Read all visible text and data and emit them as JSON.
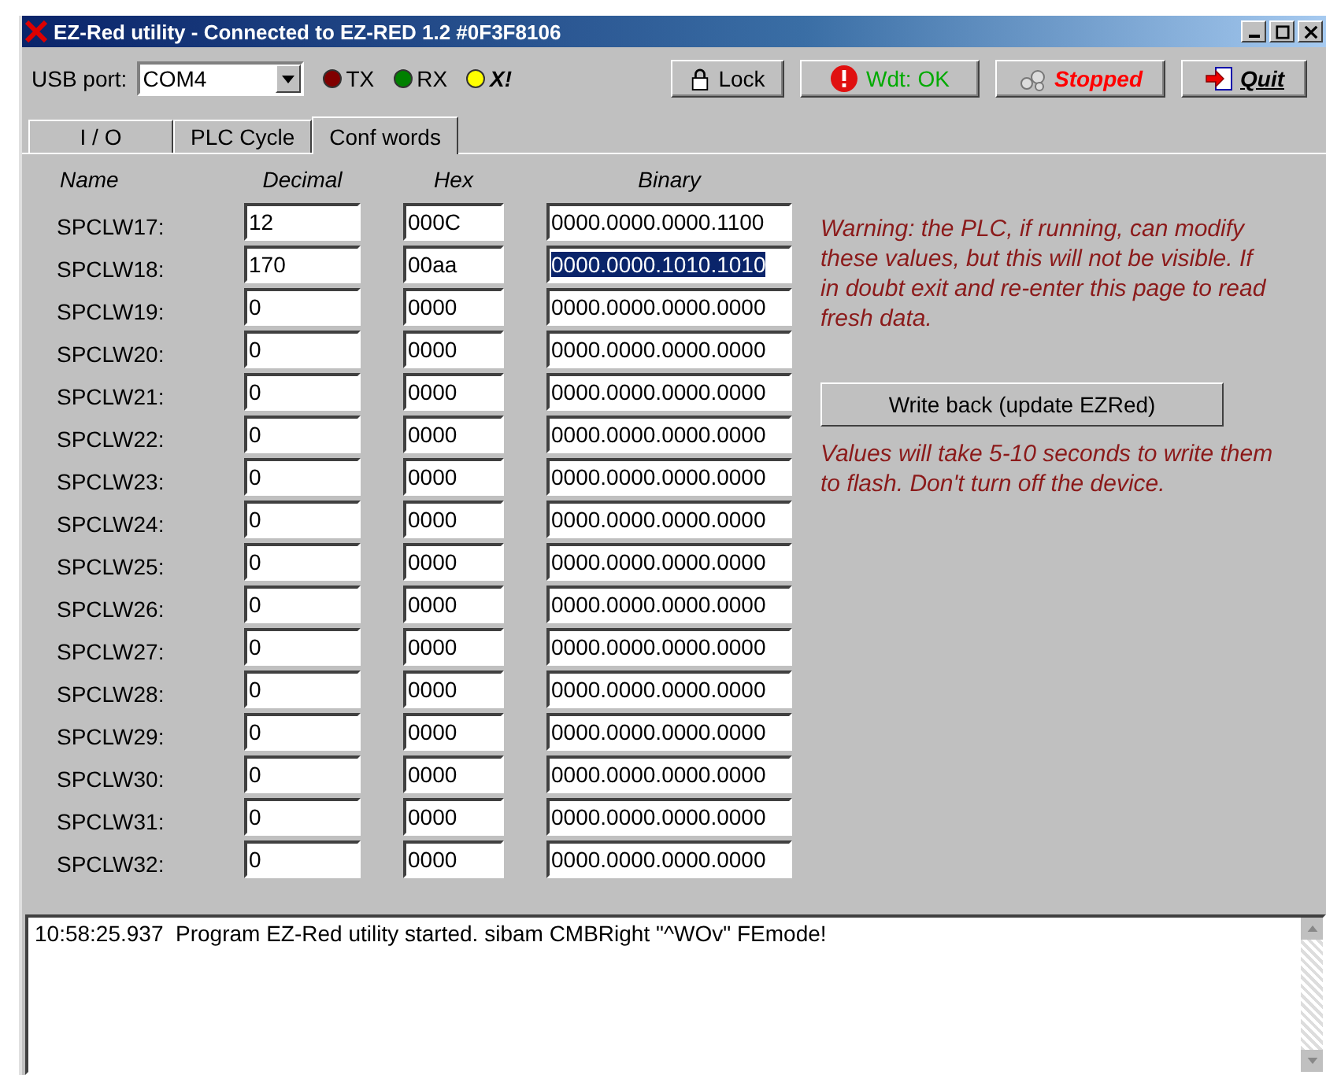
{
  "window": {
    "title": "EZ-Red utility - Connected to EZ-RED 1.2  #0F3F8106"
  },
  "toolbar": {
    "port_label": "USB port:",
    "port_value": "COM4",
    "indicators": [
      {
        "label": "TX",
        "color": "#800000"
      },
      {
        "label": "RX",
        "color": "#008000"
      },
      {
        "label": "X!",
        "color": "#ffff00"
      }
    ],
    "buttons": [
      {
        "kind": "lock",
        "label": "Lock"
      },
      {
        "kind": "wdt",
        "label": "Wdt: OK"
      },
      {
        "kind": "stopped",
        "label": "Stopped"
      },
      {
        "kind": "quit",
        "label": "Quit"
      }
    ]
  },
  "tabs": [
    {
      "label": "I / O",
      "selected": false
    },
    {
      "label": "PLC Cycle",
      "selected": false
    },
    {
      "label": "Conf words",
      "selected": true
    }
  ],
  "table": {
    "columns": [
      "Name",
      "Decimal",
      "Hex",
      "Binary"
    ],
    "rows": [
      {
        "name": "SPCLW17:",
        "decimal": "12",
        "hex": "000C",
        "binary": "0000.0000.0000.1100",
        "selected": false
      },
      {
        "name": "SPCLW18:",
        "decimal": "170",
        "hex": "00aa",
        "binary": "0000.0000.1010.1010",
        "selected": true
      },
      {
        "name": "SPCLW19:",
        "decimal": "0",
        "hex": "0000",
        "binary": "0000.0000.0000.0000",
        "selected": false
      },
      {
        "name": "SPCLW20:",
        "decimal": "0",
        "hex": "0000",
        "binary": "0000.0000.0000.0000",
        "selected": false
      },
      {
        "name": "SPCLW21:",
        "decimal": "0",
        "hex": "0000",
        "binary": "0000.0000.0000.0000",
        "selected": false
      },
      {
        "name": "SPCLW22:",
        "decimal": "0",
        "hex": "0000",
        "binary": "0000.0000.0000.0000",
        "selected": false
      },
      {
        "name": "SPCLW23:",
        "decimal": "0",
        "hex": "0000",
        "binary": "0000.0000.0000.0000",
        "selected": false
      },
      {
        "name": "SPCLW24:",
        "decimal": "0",
        "hex": "0000",
        "binary": "0000.0000.0000.0000",
        "selected": false
      },
      {
        "name": "SPCLW25:",
        "decimal": "0",
        "hex": "0000",
        "binary": "0000.0000.0000.0000",
        "selected": false
      },
      {
        "name": "SPCLW26:",
        "decimal": "0",
        "hex": "0000",
        "binary": "0000.0000.0000.0000",
        "selected": false
      },
      {
        "name": "SPCLW27:",
        "decimal": "0",
        "hex": "0000",
        "binary": "0000.0000.0000.0000",
        "selected": false
      },
      {
        "name": "SPCLW28:",
        "decimal": "0",
        "hex": "0000",
        "binary": "0000.0000.0000.0000",
        "selected": false
      },
      {
        "name": "SPCLW29:",
        "decimal": "0",
        "hex": "0000",
        "binary": "0000.0000.0000.0000",
        "selected": false
      },
      {
        "name": "SPCLW30:",
        "decimal": "0",
        "hex": "0000",
        "binary": "0000.0000.0000.0000",
        "selected": false
      },
      {
        "name": "SPCLW31:",
        "decimal": "0",
        "hex": "0000",
        "binary": "0000.0000.0000.0000",
        "selected": false
      },
      {
        "name": "SPCLW32:",
        "decimal": "0",
        "hex": "0000",
        "binary": "0000.0000.0000.0000",
        "selected": false
      }
    ]
  },
  "warning": "Warning: the PLC, if running, can modify these values, but this will not be visible. If in doubt exit and re-enter this page to read fresh data.",
  "write_button": "Write back (update EZRed)",
  "write_note": "Values will take 5-10 seconds to write them to flash. Don't turn off the device.",
  "log": [
    "10:58:25.937  Program EZ-Red utility started. sibam CMBRight \"^WOv\" FEmode!"
  ]
}
